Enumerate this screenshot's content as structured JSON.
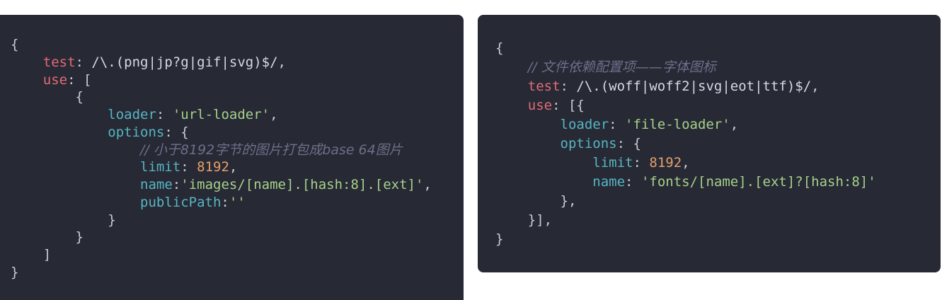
{
  "left_code": {
    "lines": [
      [
        {
          "t": "{",
          "c": "punc"
        }
      ],
      [
        {
          "t": "    ",
          "c": "plain"
        },
        {
          "t": "test",
          "c": "key"
        },
        {
          "t": ": ",
          "c": "punc"
        },
        {
          "t": "/\\.(png|jp?g|gif|svg)$/",
          "c": "regex"
        },
        {
          "t": ",",
          "c": "punc"
        }
      ],
      [
        {
          "t": "    ",
          "c": "plain"
        },
        {
          "t": "use",
          "c": "key"
        },
        {
          "t": ": [",
          "c": "punc"
        }
      ],
      [
        {
          "t": "        {",
          "c": "punc"
        }
      ],
      [
        {
          "t": "            ",
          "c": "plain"
        },
        {
          "t": "loader",
          "c": "prop"
        },
        {
          "t": ": ",
          "c": "punc"
        },
        {
          "t": "'url-loader'",
          "c": "str"
        },
        {
          "t": ",",
          "c": "punc"
        }
      ],
      [
        {
          "t": "            ",
          "c": "plain"
        },
        {
          "t": "options",
          "c": "prop"
        },
        {
          "t": ": {",
          "c": "punc"
        }
      ],
      [
        {
          "t": "                ",
          "c": "plain"
        },
        {
          "t": "// 小于8192字节的图片打包成base 64图片",
          "c": "cmt"
        }
      ],
      [
        {
          "t": "                ",
          "c": "plain"
        },
        {
          "t": "limit",
          "c": "prop"
        },
        {
          "t": ": ",
          "c": "punc"
        },
        {
          "t": "8192",
          "c": "num"
        },
        {
          "t": ",",
          "c": "punc"
        }
      ],
      [
        {
          "t": "                ",
          "c": "plain"
        },
        {
          "t": "name",
          "c": "prop"
        },
        {
          "t": ":",
          "c": "punc"
        },
        {
          "t": "'images/[name].[hash:8].[ext]'",
          "c": "str"
        },
        {
          "t": ",",
          "c": "punc"
        }
      ],
      [
        {
          "t": "                ",
          "c": "plain"
        },
        {
          "t": "publicPath",
          "c": "prop"
        },
        {
          "t": ":",
          "c": "punc"
        },
        {
          "t": "''",
          "c": "str"
        }
      ],
      [
        {
          "t": "            }",
          "c": "punc"
        }
      ],
      [
        {
          "t": "        }",
          "c": "punc"
        }
      ],
      [
        {
          "t": "    ]",
          "c": "punc"
        }
      ],
      [
        {
          "t": "}",
          "c": "punc"
        }
      ]
    ]
  },
  "right_code": {
    "lines": [
      [
        {
          "t": "{",
          "c": "punc"
        }
      ],
      [
        {
          "t": "    ",
          "c": "plain"
        },
        {
          "t": "// 文件依赖配置项——字体图标",
          "c": "cmt"
        }
      ],
      [
        {
          "t": "    ",
          "c": "plain"
        },
        {
          "t": "test",
          "c": "key"
        },
        {
          "t": ": ",
          "c": "punc"
        },
        {
          "t": "/\\.(woff|woff2|svg|eot|ttf)$/",
          "c": "regex"
        },
        {
          "t": ",",
          "c": "punc"
        }
      ],
      [
        {
          "t": "    ",
          "c": "plain"
        },
        {
          "t": "use",
          "c": "key"
        },
        {
          "t": ": [{",
          "c": "punc"
        }
      ],
      [
        {
          "t": "        ",
          "c": "plain"
        },
        {
          "t": "loader",
          "c": "prop"
        },
        {
          "t": ": ",
          "c": "punc"
        },
        {
          "t": "'file-loader'",
          "c": "str"
        },
        {
          "t": ",",
          "c": "punc"
        }
      ],
      [
        {
          "t": "        ",
          "c": "plain"
        },
        {
          "t": "options",
          "c": "prop"
        },
        {
          "t": ": {",
          "c": "punc"
        }
      ],
      [
        {
          "t": "            ",
          "c": "plain"
        },
        {
          "t": "limit",
          "c": "prop"
        },
        {
          "t": ": ",
          "c": "punc"
        },
        {
          "t": "8192",
          "c": "num"
        },
        {
          "t": ",",
          "c": "punc"
        }
      ],
      [
        {
          "t": "            ",
          "c": "plain"
        },
        {
          "t": "name",
          "c": "prop"
        },
        {
          "t": ": ",
          "c": "punc"
        },
        {
          "t": "'fonts/[name].[ext]?[hash:8]'",
          "c": "str"
        }
      ],
      [
        {
          "t": "        },",
          "c": "punc"
        }
      ],
      [
        {
          "t": "    }],",
          "c": "punc"
        }
      ],
      [
        {
          "t": "}",
          "c": "punc"
        }
      ]
    ]
  }
}
